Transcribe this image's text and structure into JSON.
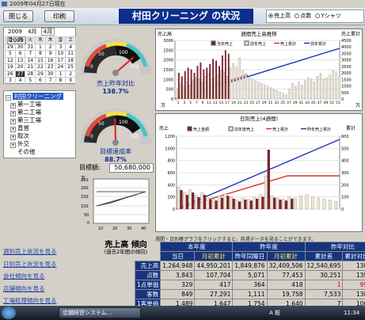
{
  "window": {
    "title": "2009年04月27日現在"
  },
  "header": {
    "close_label": "閉じる",
    "print_label": "印刷",
    "app_title": "村田クリーニング の状況",
    "radios": [
      {
        "label": "売上高",
        "selected": true
      },
      {
        "label": "点数",
        "selected": false
      },
      {
        "label": "Yシャツ",
        "selected": false
      }
    ]
  },
  "calendar": {
    "year": "2009",
    "month": "4月",
    "month_select": "4月",
    "year_select": "2009",
    "weekdays": [
      "日",
      "月",
      "火",
      "水",
      "木",
      "金",
      "土"
    ],
    "rows": [
      [
        "29",
        "30",
        "31",
        "1",
        "2",
        "3",
        "4"
      ],
      [
        "5",
        "6",
        "7",
        "8",
        "9",
        "10",
        "11"
      ],
      [
        "12",
        "13",
        "14",
        "15",
        "16",
        "17",
        "18"
      ],
      [
        "19",
        "20",
        "21",
        "22",
        "23",
        "24",
        "25"
      ],
      [
        "26",
        "27",
        "28",
        "29",
        "30",
        "1",
        "2"
      ],
      [
        "3",
        "4",
        "5",
        "6",
        "7",
        "8",
        "9"
      ]
    ],
    "selected_day": "27"
  },
  "tree": {
    "root": "村田クリーニング",
    "items": [
      "第一工場",
      "第二工場",
      "第三工場",
      "直営",
      "取次",
      "外交",
      "その他"
    ]
  },
  "gauge1": {
    "scale": [
      "0",
      "50",
      "100",
      "150"
    ],
    "caption": "売上昨年対比",
    "value": "138.7%",
    "percent": 138.7
  },
  "gauge2": {
    "scale": [
      "0",
      "50",
      "100",
      "150"
    ],
    "caption": "目標達成率",
    "value": "88.7%",
    "percent": 88.7
  },
  "target": {
    "label": "目標額:",
    "value": "50,680,000"
  },
  "mini_chart": {
    "unit": "万",
    "yticks": [
      "250",
      "200",
      "150",
      "100",
      "50",
      "0"
    ],
    "xticks": [
      "10",
      "20",
      "30",
      "40"
    ]
  },
  "weekly_chart": {
    "title": "週間売上高推移",
    "left_label": "売上高",
    "right_label": "売上累計",
    "unit_left": "万",
    "unit_right": "万",
    "legend": [
      "当年売上",
      "前年売上",
      "売上累計",
      "前年累計"
    ],
    "colors": {
      "current": "#7b2430",
      "previous": "#f0e6d0",
      "cum": "#e03020",
      "prev_cum": "#2030c0"
    },
    "yticks": [
      "3000",
      "2500",
      "2000",
      "1500",
      "1000",
      "500",
      "0"
    ],
    "y2ticks": [
      "4500",
      "4000",
      "3500",
      "3000",
      "2500",
      "2000",
      "1500",
      "1000",
      "500",
      "0"
    ],
    "xticks": [
      "1",
      "3",
      "5",
      "7",
      "9",
      "11",
      "13",
      "15",
      "17",
      "19",
      "21",
      "23",
      "25",
      "27",
      "29",
      "31",
      "33",
      "35",
      "37",
      "39",
      "41",
      "43",
      "45",
      "47",
      "49",
      "51",
      "53"
    ]
  },
  "daily_chart": {
    "title": "日別売上(4週間)",
    "left_label": "売上",
    "right_label": "累計",
    "legend": [
      "売上金額",
      "前年度売上",
      "売上累計",
      "昨年売上累計"
    ],
    "yticks": [
      "1200",
      "1000",
      "800",
      "600",
      "400",
      "200",
      "0"
    ],
    "y2ticks": [
      "600",
      "500",
      "400",
      "300",
      "200",
      "100",
      "0"
    ]
  },
  "trend": {
    "title": "売上高 傾向",
    "subtitle": "(過去2年間の傾向)"
  },
  "links": [
    "週別売上状況を見る",
    "日別売上状況を見る",
    "会社傾向を見る",
    "店舗傾向を見る",
    "工場処理傾向を見る"
  ],
  "note": "週間・日別棒グラフをクリックすると、前週データを見ることができます。",
  "table": {
    "groups": [
      "本年度",
      "昨年度",
      "昨年対比"
    ],
    "cols": [
      "当日",
      "月初累計",
      "昨年同曜日",
      "月初累計",
      "累計差",
      "累計対比(%)"
    ],
    "rows": [
      {
        "label": "売上高",
        "vals": [
          "1,264,948",
          "44,950,201",
          "1,849,876",
          "32,409,506",
          "12,540,695",
          "138.7%"
        ]
      },
      {
        "label": "点数",
        "vals": [
          "3,843",
          "107,704",
          "5,071",
          "77,453",
          "30,251",
          "139.1%"
        ]
      },
      {
        "label": "1点単価",
        "vals": [
          "329",
          "417",
          "364",
          "418",
          "1",
          "99.8%"
        ]
      },
      {
        "label": "客数",
        "vals": [
          "849",
          "27,291",
          "1,111",
          "19,758",
          "7,533",
          "138.1%"
        ]
      },
      {
        "label": "1客単価",
        "vals": [
          "1,489",
          "1,647",
          "1,754",
          "1,640",
          "7",
          "100.4%"
        ]
      }
    ]
  },
  "taskbar": {
    "task_label": "店舗経営システム...",
    "clock": "11:34",
    "lang": "A 般"
  }
}
